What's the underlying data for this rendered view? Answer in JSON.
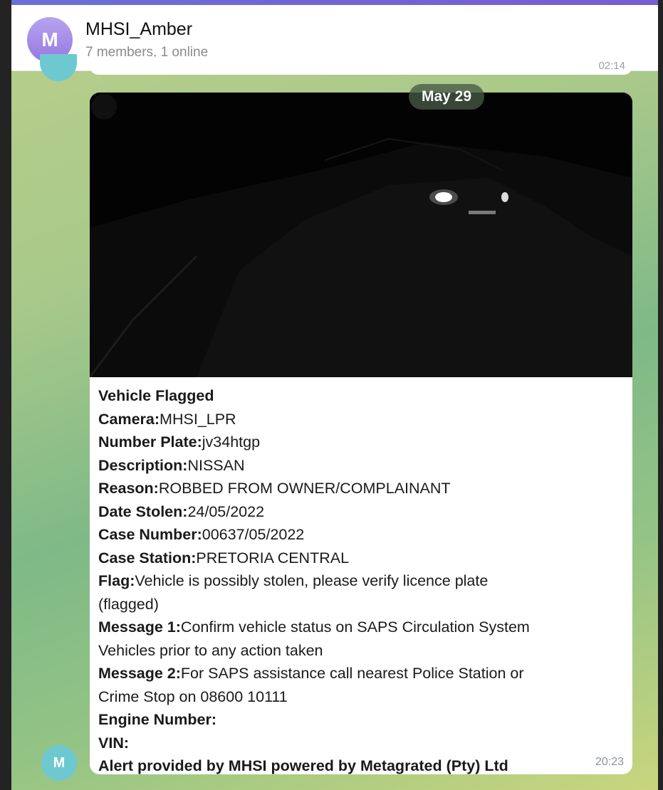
{
  "header": {
    "avatar_letter": "M",
    "title": "MHSI_Amber",
    "subtitle": "7 members, 1 online"
  },
  "previous_message": {
    "time": "02:14"
  },
  "date_separator": "May 29",
  "message": {
    "sender_avatar_letter": "M",
    "image_alt": "LPR camera capture of vehicle at night",
    "time": "20:23",
    "lines": [
      {
        "label": "Vehicle Flagged",
        "value": ""
      },
      {
        "label": "Camera:",
        "value": "MHSI_LPR"
      },
      {
        "label": "Number Plate:",
        "value": "jv34htgp"
      },
      {
        "label": "Description:",
        "value": "NISSAN"
      },
      {
        "label": "Reason:",
        "value": "ROBBED FROM OWNER/COMPLAINANT"
      },
      {
        "label": "Date Stolen:",
        "value": "24/05/2022"
      },
      {
        "label": "Case Number:",
        "value": "00637/05/2022"
      },
      {
        "label": "Case Station:",
        "value": "PRETORIA CENTRAL"
      },
      {
        "label": "Flag:",
        "value": "Vehicle is possibly stolen, please verify licence plate"
      },
      {
        "label": "",
        "value": "(flagged)"
      },
      {
        "label": "Message 1:",
        "value": "Confirm vehicle status on SAPS Circulation System"
      },
      {
        "label": "",
        "value": "Vehicles prior to any action taken"
      },
      {
        "label": "Message 2:",
        "value": "For SAPS assistance call nearest Police Station or"
      },
      {
        "label": "",
        "value": "Crime Stop on 08600 10111"
      },
      {
        "label": "Engine Number:",
        "value": ""
      },
      {
        "label": "VIN:",
        "value": ""
      },
      {
        "label": "Alert provided by MHSI powered by Metagrated (Pty) Ltd",
        "value": ""
      }
    ]
  },
  "colors": {
    "accent_bar": "#6a6fd6",
    "group_avatar": "#9678e0",
    "sender_avatar": "#6ec8d0",
    "date_pill": "#465a46"
  }
}
